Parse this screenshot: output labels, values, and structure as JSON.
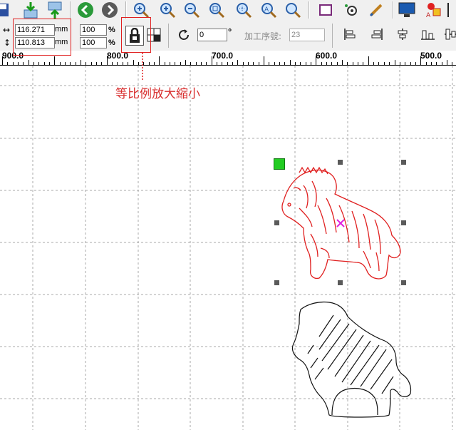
{
  "toolbar": {
    "icons": [
      "save-icon",
      "import-icon",
      "export-icon",
      "back-icon",
      "forward-icon",
      "zoom-fit-icon",
      "zoom-in-icon",
      "zoom-out-icon",
      "zoom-page-icon",
      "zoom-grid-icon",
      "zoom-select-icon",
      "search-icon",
      "rectangle-icon",
      "settings-icon",
      "edit-icon",
      "monitor-icon",
      "palette-icon"
    ]
  },
  "size": {
    "width": "116.271",
    "height": "110.813",
    "unit": "mm",
    "scale_x": "100",
    "scale_y": "100",
    "percent": "%"
  },
  "rotation": {
    "value": "0",
    "unit": "°"
  },
  "process_order": {
    "label": "加工序號:",
    "value": "23"
  },
  "ruler": {
    "labels": [
      "900.0",
      "800.0",
      "700.0",
      "600.0",
      "500.0"
    ]
  },
  "annotation": {
    "text": "等比例放大縮小"
  },
  "colors": {
    "selected_outline": "#e02020",
    "handle": "#606060",
    "anchor": "#22cc22",
    "center_mark": "#e020e0",
    "grid": "#a0a0a0"
  }
}
